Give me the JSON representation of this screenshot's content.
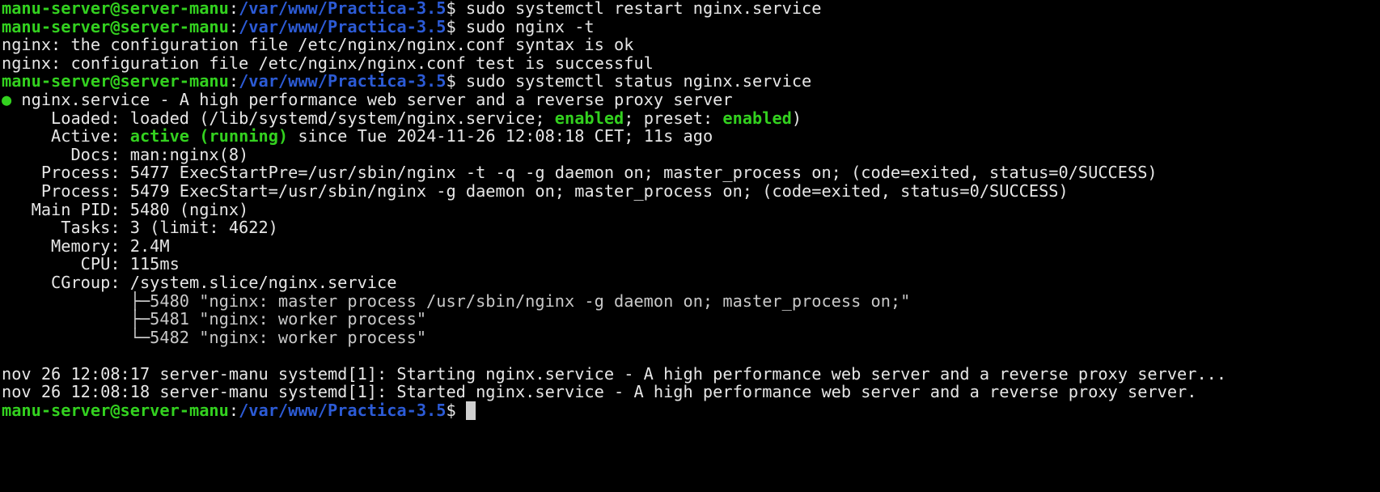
{
  "colors": {
    "background": "#000000",
    "text": "#e6e6e6",
    "user_host": "#33d11f",
    "path": "#2c5bd6",
    "status_green": "#33d11f"
  },
  "prompt": {
    "user_host": "manu-server@server-manu",
    "colon": ":",
    "path": "/var/www/Practica-3.5",
    "symbol": "$ "
  },
  "commands": {
    "restart": "sudo systemctl restart nginx.service",
    "test": "sudo nginx -t",
    "status": "sudo systemctl status nginx.service"
  },
  "nginx_test_output": [
    "nginx: the configuration file /etc/nginx/nginx.conf syntax is ok",
    "nginx: configuration file /etc/nginx/nginx.conf test is successful"
  ],
  "status": {
    "bullet": "●",
    "header": " nginx.service - A high performance web server and a reverse proxy server",
    "loaded_label": "     Loaded: ",
    "loaded_pre": "loaded (/lib/systemd/system/nginx.service; ",
    "loaded_enabled": "enabled",
    "loaded_mid": "; preset: ",
    "loaded_preset": "enabled",
    "loaded_post": ")",
    "active_label": "     Active: ",
    "active_state": "active (running)",
    "active_since": " since Tue 2024-11-26 12:08:18 CET; 11s ago",
    "docs": "       Docs: man:nginx(8)",
    "process1": "    Process: 5477 ExecStartPre=/usr/sbin/nginx -t -q -g daemon on; master_process on; (code=exited, status=0/SUCCESS)",
    "process2": "    Process: 5479 ExecStart=/usr/sbin/nginx -g daemon on; master_process on; (code=exited, status=0/SUCCESS)",
    "main_pid": "   Main PID: 5480 (nginx)",
    "tasks": "      Tasks: 3 (limit: 4622)",
    "memory": "     Memory: 2.4M",
    "cpu": "        CPU: 115ms",
    "cgroup": "     CGroup: /system.slice/nginx.service",
    "tree": [
      "             ├─5480 \"nginx: master process /usr/sbin/nginx -g daemon on; master_process on;\"",
      "             ├─5481 \"nginx: worker process\"",
      "             └─5482 \"nginx: worker process\""
    ]
  },
  "journal": [
    "nov 26 12:08:17 server-manu systemd[1]: Starting nginx.service - A high performance web server and a reverse proxy server...",
    "nov 26 12:08:18 server-manu systemd[1]: Started nginx.service - A high performance web server and a reverse proxy server."
  ]
}
